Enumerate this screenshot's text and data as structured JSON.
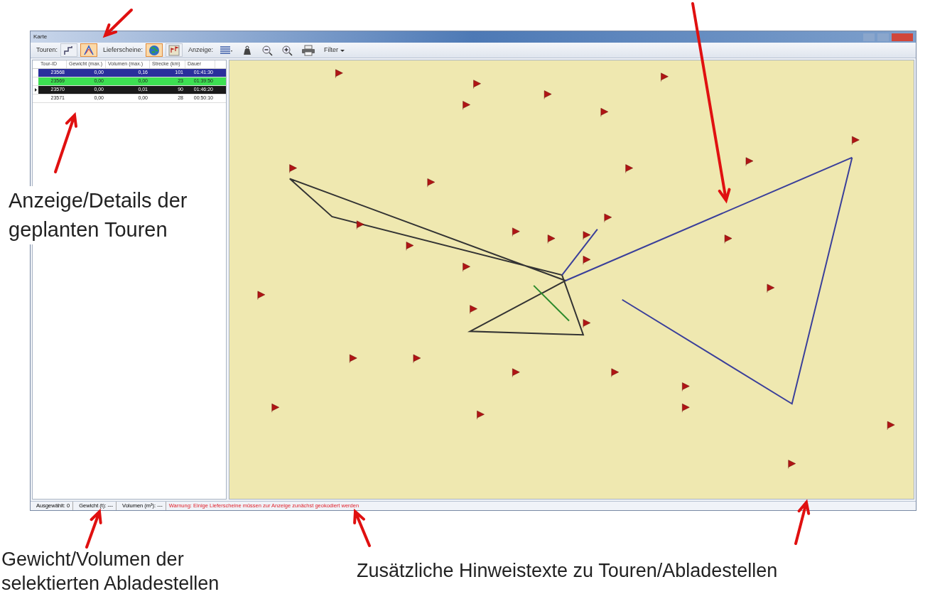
{
  "window": {
    "title": "Karte"
  },
  "toolbar": [
    {
      "kind": "label",
      "text": "Touren:"
    },
    {
      "kind": "steps",
      "selected": false
    },
    {
      "kind": "route",
      "selected": true
    },
    {
      "kind": "label",
      "text": "Lieferscheine:"
    },
    {
      "kind": "globe",
      "selected": true
    },
    {
      "kind": "points",
      "selected": false
    },
    {
      "kind": "label",
      "text": "Anzeige:"
    },
    {
      "kind": "list"
    },
    {
      "kind": "weight"
    },
    {
      "kind": "zoomout"
    },
    {
      "kind": "zoomin"
    },
    {
      "kind": "printer"
    },
    {
      "kind": "menu",
      "text": "Filter"
    }
  ],
  "table": {
    "columns": [
      "Tour-ID",
      "Gewicht (max.)",
      "Volumen (max.)",
      "Strecke (km)",
      "Dauer"
    ],
    "rows": [
      {
        "cells": [
          "23568",
          "0,00",
          "0,16",
          "101",
          "01:41:30"
        ],
        "color": "#2a2f9c",
        "current": false
      },
      {
        "cells": [
          "23569",
          "0,00",
          "0,00",
          "23",
          "01:39:50"
        ],
        "color": "#3de052",
        "current": false
      },
      {
        "cells": [
          "23570",
          "0,00",
          "0,01",
          "90",
          "01:46:20"
        ],
        "color": "#1a1a1a",
        "current": true
      },
      {
        "cells": [
          "23571",
          "0,00",
          "0,00",
          "28",
          "00:50:10"
        ],
        "color": "#ffffff",
        "current": false
      }
    ]
  },
  "status_bar": {
    "items": [
      "Ausgewählt: 0",
      "Gewicht (t): ---",
      "Volumen (m³): ---"
    ],
    "warning": "Warnung: Einige Lieferscheine müssen zur Anzeige zunächst geokodiert werden"
  },
  "annotations": [
    "Anzeige/Details der geplanten Touren",
    "Gewicht/Volumen der selektierten Abladestellen",
    "Zusätzliche Hinweistexte zu Touren/Abladestellen"
  ]
}
